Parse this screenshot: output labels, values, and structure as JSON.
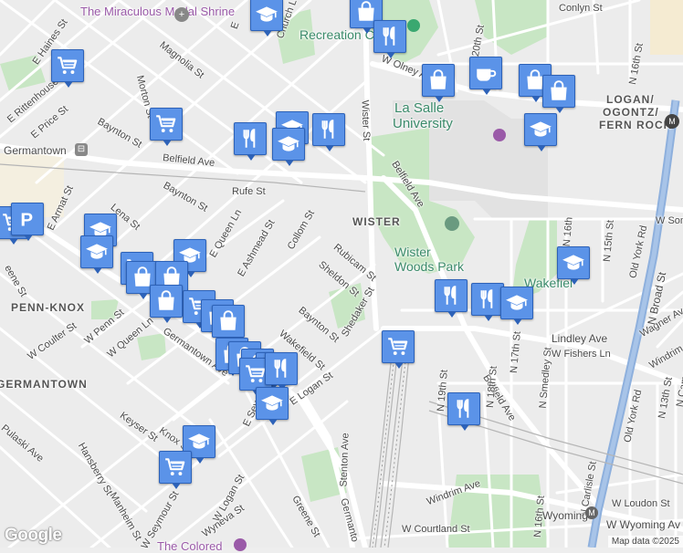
{
  "map": {
    "neighborhoods": [
      "WISTER",
      "PENN-KNOX",
      "GERMANTOWN",
      "LOGAN/",
      "OGONTZ/",
      "FERN ROCK"
    ],
    "places": {
      "medal_shrine": "The Miraculous Medal Shrine",
      "recreation": "Recreation C",
      "la_salle_1": "La Salle",
      "la_salle_2": "University",
      "wister_woods_1": "Wister",
      "wister_woods_2": "Woods Park",
      "germantown_place": "Germantown",
      "wakefield": "Wakefiel",
      "colored": "The Colored"
    },
    "streets": {
      "conlyn": "Conlyn St",
      "church": "Church Ln",
      "magnolia": "Magnolia St",
      "haines": "E Haines St",
      "rittenhouse": "E Rittenhouse St",
      "price": "E Price St",
      "morton": "Morton St",
      "bayton1": "Baynton St",
      "bayton2": "Baynton St",
      "bayton3": "Baynton St",
      "belfield1": "Belfield Ave",
      "belfield2": "Belfield Ave",
      "belfield3": "Belfield Ave",
      "rufe": "Rufe St",
      "armat": "E Armat St",
      "lena": "Lena St",
      "queen_ln": "E Queen Ln",
      "ashmead": "E Ashmead St",
      "collom": "Collom St",
      "rubicam": "Rubicam St",
      "sheldon": "Sheldon St",
      "shedaker": "Shedaker St",
      "wakefield_st": "Wakefield St",
      "w_penn": "W Penn St",
      "w_queen_ln": "W Queen Ln",
      "w_coulter": "W Coulter St",
      "germantown_ave": "Germantown Ave",
      "seymour": "E Seymour St",
      "e_logan": "E Logan St",
      "keyser": "Keyser St",
      "knox": "Knox St",
      "pulaski": "Pulaski Ave",
      "hansberry": "Hansberry St",
      "manheim": "Manheim St",
      "w_seymour": "W Seymour St",
      "w_logan": "W Logan St",
      "wyneva": "Wyneva St",
      "greene": "Greene St",
      "stenton": "Stenton Ave",
      "germanto": "Germanto",
      "wister_st": "Wister St",
      "w_olney": "W Olney Ave",
      "n20th": "N 20th St",
      "n16th_top": "N 16th St",
      "n19th": "N 19th St",
      "n18th": "N 18th St",
      "n17th": "N 17th St",
      "smedley": "N Smedley St",
      "n16th": "N 16th St",
      "n15th": "N 15th St",
      "w_fishers": "W Fishers Ln",
      "lindley": "Lindley Ave",
      "wagner": "Wagner Ave",
      "windrim1": "Windrim Ave",
      "windrim2": "Windrim Ave",
      "old_york1": "Old York Rd",
      "old_york2": "Old York Rd",
      "n_broad": "N Broad St",
      "n13th": "N 13th St",
      "n_camac": "N Cama",
      "carlisle": "N Carlisle St",
      "w_loudon": "W Loudon St",
      "w_courtland": "W Courtland St",
      "wyoming1": "Wyoming",
      "wyoming2": "W Wyoming Av",
      "w_som": "W Som",
      "n16th_mid": "N 16th",
      "rene": "eene St",
      "gton_st": "gton St",
      "hm_st": "hm St",
      "e_uvs": "E"
    },
    "google": "Google",
    "attribution": "Map data ©2025",
    "icons": {
      "grocery": "shopping-cart-icon",
      "restaurant": "fork-knife-icon",
      "school": "graduation-cap-icon",
      "shopping": "shopping-bag-icon",
      "cafe": "coffee-cup-icon",
      "parking": "parking-icon"
    },
    "colors": {
      "pin": "#5b93e8",
      "park": "#c7e6c3",
      "road": "#ffffff",
      "highway": "#8eb0dd",
      "land": "#eeeeee"
    }
  }
}
